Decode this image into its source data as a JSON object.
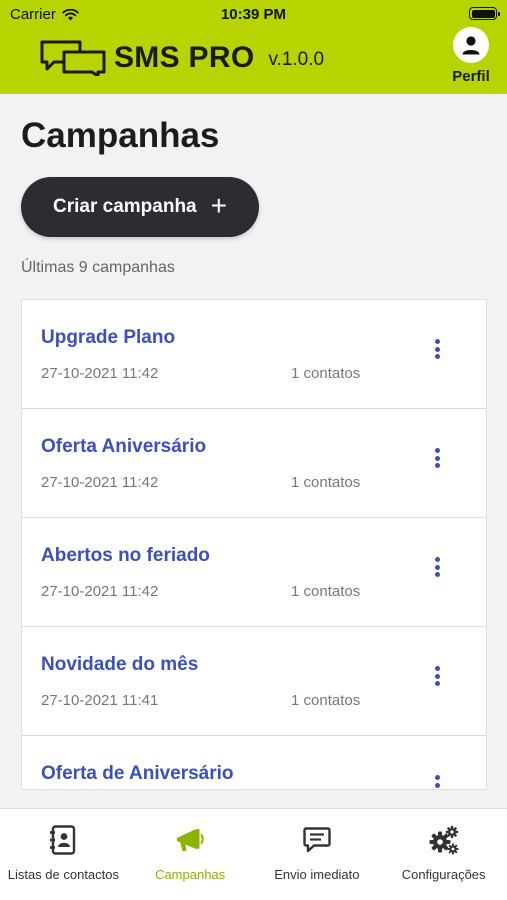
{
  "status_bar": {
    "carrier": "Carrier",
    "time": "10:39 PM"
  },
  "header": {
    "brand": "SMS PRO",
    "version": "v.1.0.0",
    "profile_label": "Perfil"
  },
  "page": {
    "title": "Campanhas",
    "create_label": "Criar campanha",
    "create_icon": "+",
    "subtitle": "Últimas 9 campanhas"
  },
  "campaigns": [
    {
      "name": "Upgrade Plano",
      "date": "27-10-2021 11:42",
      "contacts": "1 contatos"
    },
    {
      "name": "Oferta Aniversário",
      "date": "27-10-2021 11:42",
      "contacts": "1 contatos"
    },
    {
      "name": "Abertos no feriado",
      "date": "27-10-2021 11:42",
      "contacts": "1 contatos"
    },
    {
      "name": "Novidade do mês",
      "date": "27-10-2021 11:41",
      "contacts": "1 contatos"
    },
    {
      "name": "Oferta de Aniversário",
      "date": "",
      "contacts": ""
    }
  ],
  "tabs": [
    {
      "label": "Listas de contactos",
      "icon": "contacts-book-icon",
      "active": false
    },
    {
      "label": "Campanhas",
      "icon": "megaphone-icon",
      "active": true
    },
    {
      "label": "Envio imediato",
      "icon": "message-icon",
      "active": false
    },
    {
      "label": "Configurações",
      "icon": "gears-icon",
      "active": false
    }
  ],
  "colors": {
    "brand": "#b8d400",
    "link": "#3c4fbe",
    "active_tab": "#8bb400",
    "button": "#2b2d30"
  }
}
